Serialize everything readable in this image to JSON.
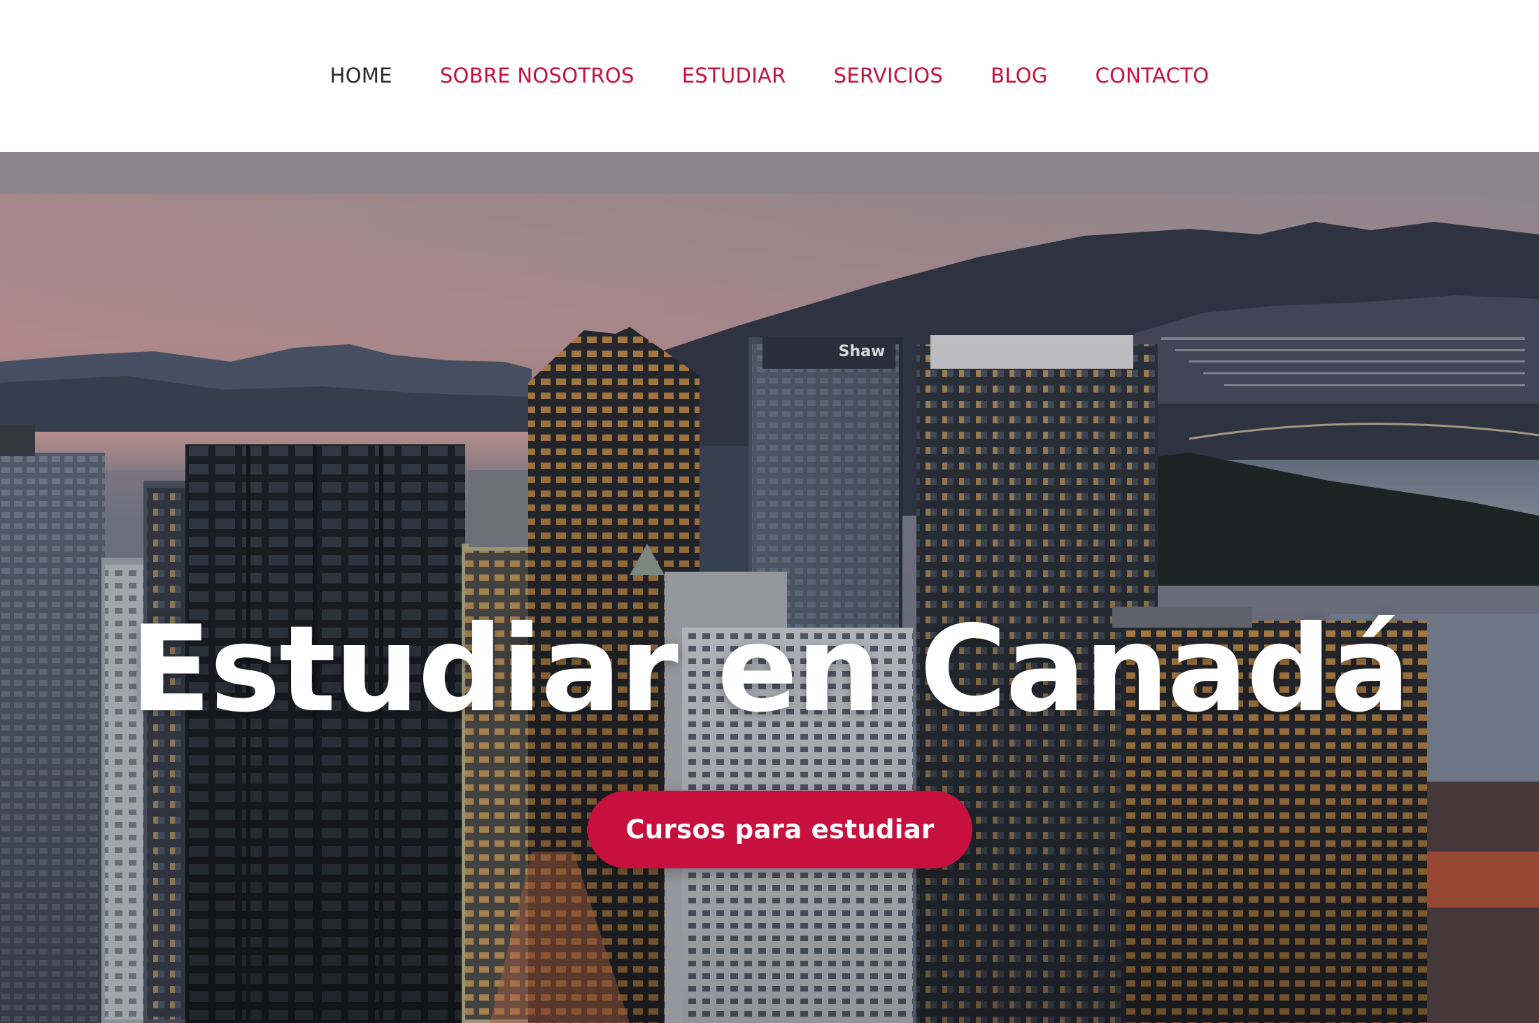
{
  "nav": {
    "items": [
      {
        "label": "HOME",
        "active": true
      },
      {
        "label": "SOBRE NOSOTROS",
        "active": false
      },
      {
        "label": "ESTUDIAR",
        "active": false
      },
      {
        "label": "SERVICIOS",
        "active": false
      },
      {
        "label": "BLOG",
        "active": false
      },
      {
        "label": "CONTACTO",
        "active": false
      }
    ]
  },
  "hero": {
    "title": "Estudiar en Canadá",
    "cta_label": "Cursos para estudiar",
    "image_subject": "city-skyline-photo",
    "sign_text": "Shaw"
  },
  "colors": {
    "accent": "#c8103e",
    "nav_active": "#2a2a2a",
    "background": "#ffffff",
    "hero_text": "#ffffff"
  }
}
